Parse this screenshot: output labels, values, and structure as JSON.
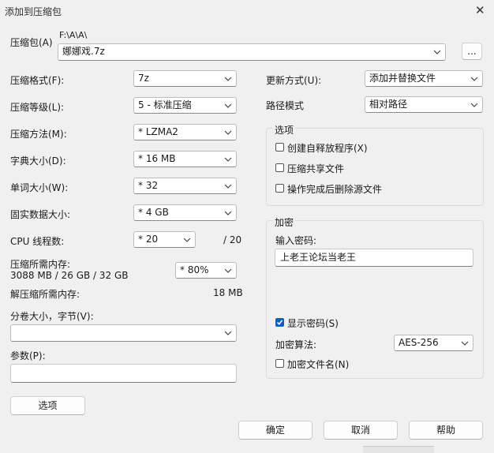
{
  "window": {
    "title": "添加到压缩包",
    "close_glyph": "✕"
  },
  "archive": {
    "label": "压缩包(A)",
    "path": "F:\\A\\A\\",
    "filename": "娜娜戏.7z",
    "browse_label": "..."
  },
  "left": {
    "format": {
      "label": "压缩格式(F):",
      "value": "7z"
    },
    "level": {
      "label": "压缩等级(L):",
      "value": "5 - 标准压缩"
    },
    "method": {
      "label": "压缩方法(M):",
      "value": "* LZMA2"
    },
    "dict": {
      "label": "字典大小(D):",
      "value": "* 16 MB"
    },
    "word": {
      "label": "单词大小(W):",
      "value": "* 32"
    },
    "solid": {
      "label": "固实数据大小:",
      "value": "* 4 GB"
    },
    "threads": {
      "label": "CPU 线程数:",
      "value": "* 20",
      "max": "/ 20"
    },
    "mem_compress": {
      "label": "压缩所需内存:",
      "detail": "3088 MB / 26 GB / 32 GB",
      "value": "* 80%"
    },
    "mem_decompress": {
      "label": "解压缩所需内存:",
      "value": "18 MB"
    },
    "split": {
      "label": "分卷大小，字节(V):",
      "value": ""
    },
    "params": {
      "label": "参数(P):",
      "value": ""
    },
    "options_button": "选项"
  },
  "right": {
    "update": {
      "label": "更新方式(U):",
      "value": "添加并替换文件"
    },
    "path_mode": {
      "label": "路径模式",
      "value": "相对路径"
    },
    "options_group": {
      "title": "选项",
      "items": [
        {
          "label": "创建自释放程序(X)",
          "checked": false
        },
        {
          "label": "压缩共享文件",
          "checked": false
        },
        {
          "label": "操作完成后删除源文件",
          "checked": false
        }
      ]
    },
    "encryption": {
      "title": "加密",
      "password_label": "输入密码:",
      "password_value": "上老王论坛当老王",
      "show_password": {
        "label": "显示密码(S)",
        "checked": true
      },
      "method_label": "加密算法:",
      "method_value": "AES-256",
      "encrypt_names": {
        "label": "加密文件名(N)",
        "checked": false
      }
    }
  },
  "buttons": {
    "ok": "确定",
    "cancel": "取消",
    "help": "帮助"
  }
}
